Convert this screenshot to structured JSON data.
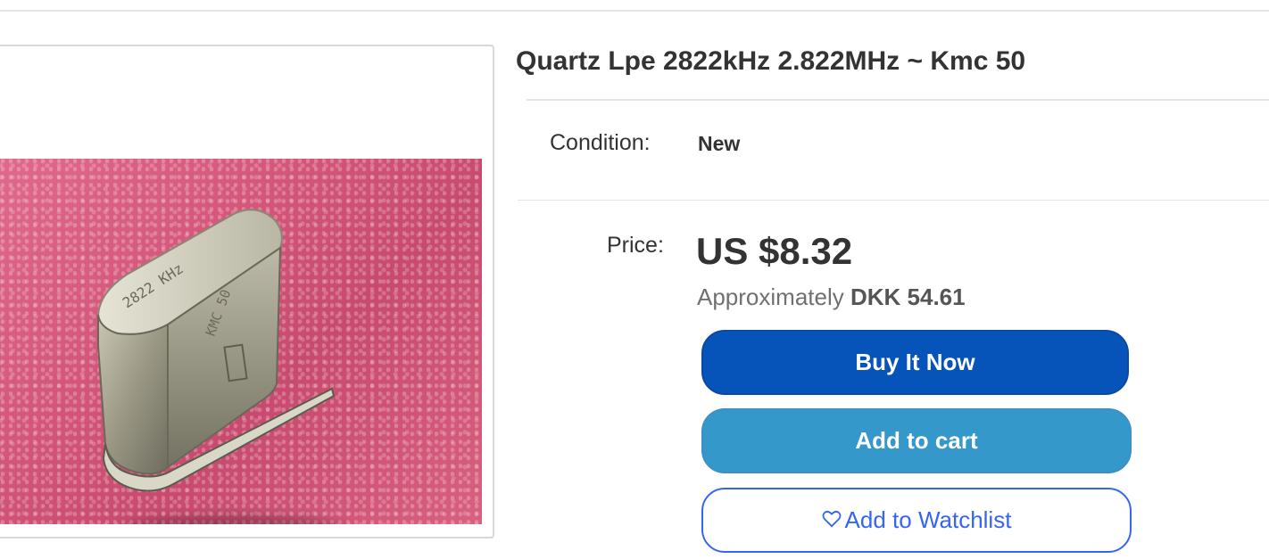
{
  "listing": {
    "title": "Quartz Lpe 2822kHz 2.822MHz ~ Kmc 50",
    "image": {
      "crystal_markings": [
        "2822 KHz",
        "KMC 50"
      ],
      "icon": "product-photo"
    }
  },
  "condition": {
    "label": "Condition:",
    "value": "New"
  },
  "price": {
    "label": "Price:",
    "value": "US $8.32",
    "approx_prefix": "Approximately",
    "approx_value": "DKK 54.61"
  },
  "actions": {
    "buy_now": "Buy It Now",
    "add_to_cart": "Add to cart",
    "watchlist": "Add to Watchlist",
    "watchlist_icon": "heart-outline-icon"
  },
  "colors": {
    "buy_now_bg": "#0654ba",
    "add_to_cart_bg": "#3498ca",
    "watchlist_border": "#3665f3"
  }
}
